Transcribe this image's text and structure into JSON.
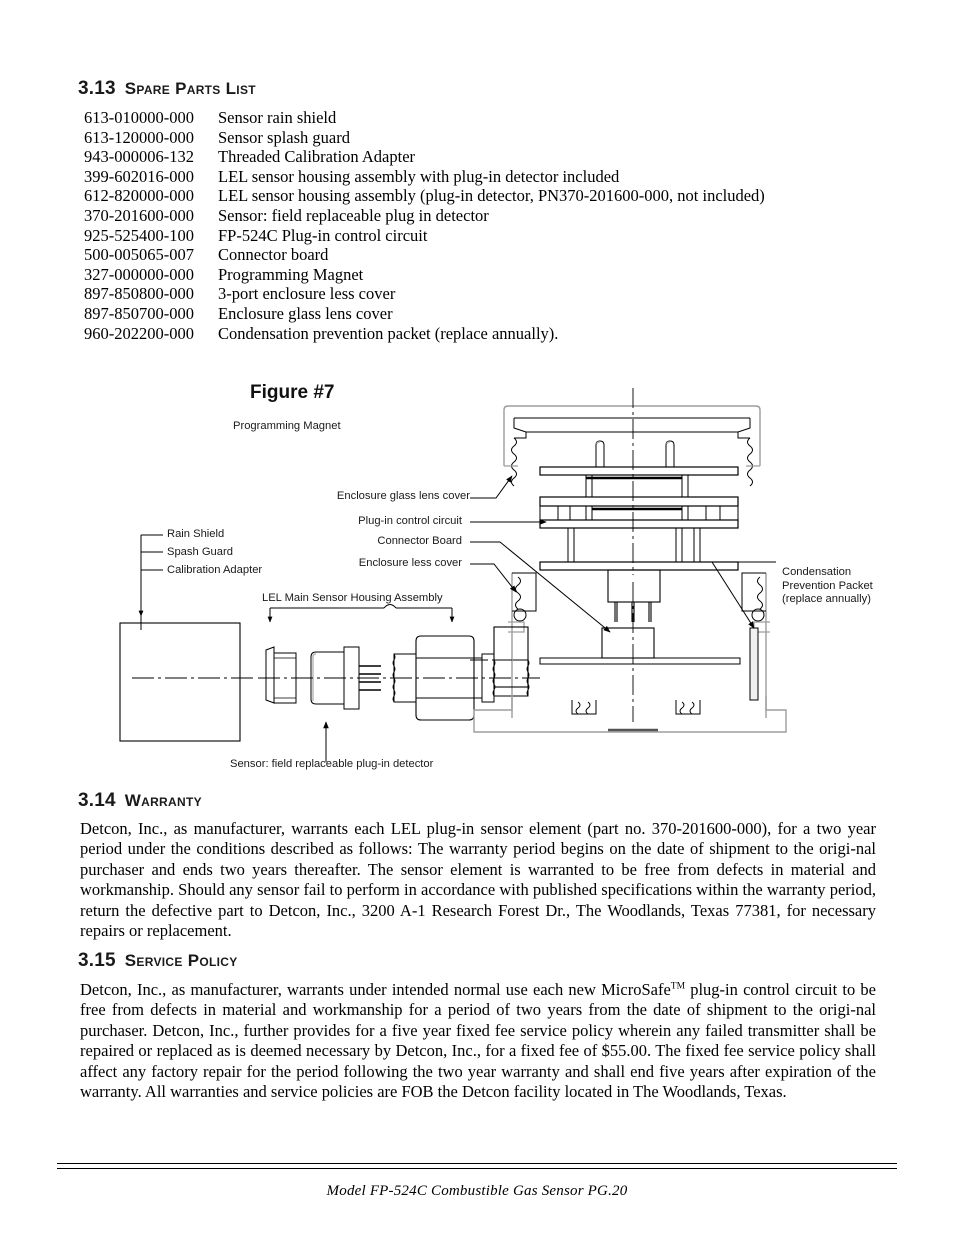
{
  "sections": {
    "spare_parts": {
      "number": "3.13",
      "title": "Spare Parts List"
    },
    "warranty": {
      "number": "3.14",
      "title": "Warranty"
    },
    "service": {
      "number": "3.15",
      "title": "Service Policy"
    }
  },
  "parts_list": [
    {
      "pn": "613-010000-000",
      "desc": "Sensor rain shield"
    },
    {
      "pn": "613-120000-000",
      "desc": "Sensor splash guard"
    },
    {
      "pn": "943-000006-132",
      "desc": "Threaded Calibration Adapter"
    },
    {
      "pn": "399-602016-000",
      "desc": "LEL sensor housing assembly with plug-in detector included"
    },
    {
      "pn": "612-820000-000",
      "desc": "LEL sensor housing assembly (plug-in detector, PN370-201600-000, not included)"
    },
    {
      "pn": "370-201600-000",
      "desc": "Sensor: field replaceable plug in detector"
    },
    {
      "pn": "925-525400-100",
      "desc": "FP-524C Plug-in control circuit"
    },
    {
      "pn": "500-005065-007",
      "desc": "Connector board"
    },
    {
      "pn": "327-000000-000",
      "desc": "Programming Magnet"
    },
    {
      "pn": "897-850800-000",
      "desc": "3-port enclosure less cover"
    },
    {
      "pn": "897-850700-000",
      "desc": "Enclosure glass lens cover"
    },
    {
      "pn": "960-202200-000",
      "desc": "Condensation prevention packet (replace annually)."
    }
  ],
  "figure": {
    "title": "Figure #7",
    "labels": {
      "programming_magnet": "Programming Magnet",
      "enclosure_glass_lens_cover": "Enclosure glass lens cover",
      "plug_in_control_circuit": "Plug-in control circuit",
      "connector_board": "Connector Board",
      "enclosure_less_cover": "Enclosure less cover",
      "rain_shield": "Rain Shield",
      "spash_guard": "Spash Guard",
      "calibration_adapter": "Calibration Adapter",
      "lel_main_sensor_housing_assembly": "LEL Main Sensor Housing Assembly",
      "sensor_field_replaceable": "Sensor: field replaceable plug-in detector",
      "condensation_line1": "Condensation",
      "condensation_line2": "Prevention Packet",
      "condensation_line3": "(replace annually)"
    }
  },
  "warranty_text": "Detcon, Inc., as manufacturer, warrants each LEL plug-in sensor element (part no. 370-201600-000), for a two year period under the conditions described as follows: The warranty period begins on the date of shipment to the origi-nal purchaser and ends two years thereafter. The sensor element is warranted to be free from defects in material and workmanship. Should any sensor fail to perform in accordance with published specifications within the warranty period, return the defective part to Detcon, Inc., 3200 A-1 Research Forest Dr., The Woodlands, Texas 77381, for necessary repairs or replacement.",
  "service_text_before_tm": "Detcon, Inc., as manufacturer, warrants under intended normal use each new MicroSafe",
  "service_tm": "TM",
  "service_text_after_tm": " plug-in control circuit to be free from defects in material and workmanship for a period of two years from the date of shipment to the origi-nal purchaser. Detcon, Inc., further provides for a five year fixed fee service policy wherein any failed transmitter shall be repaired or replaced as is deemed necessary by Detcon, Inc., for a fixed fee of $55.00. The fixed fee service policy shall affect any factory repair for the period following the two year warranty and shall end five years after expiration of the warranty. All warranties and service policies are FOB the Detcon facility located in The Woodlands, Texas.",
  "footer": {
    "text": "Model FP-524C Combustible Gas Sensor    PG.20"
  },
  "colors": {
    "ink": "#000000",
    "heading": "#1a1a1a",
    "line": "#000000",
    "light_line": "#9a9a9a"
  }
}
